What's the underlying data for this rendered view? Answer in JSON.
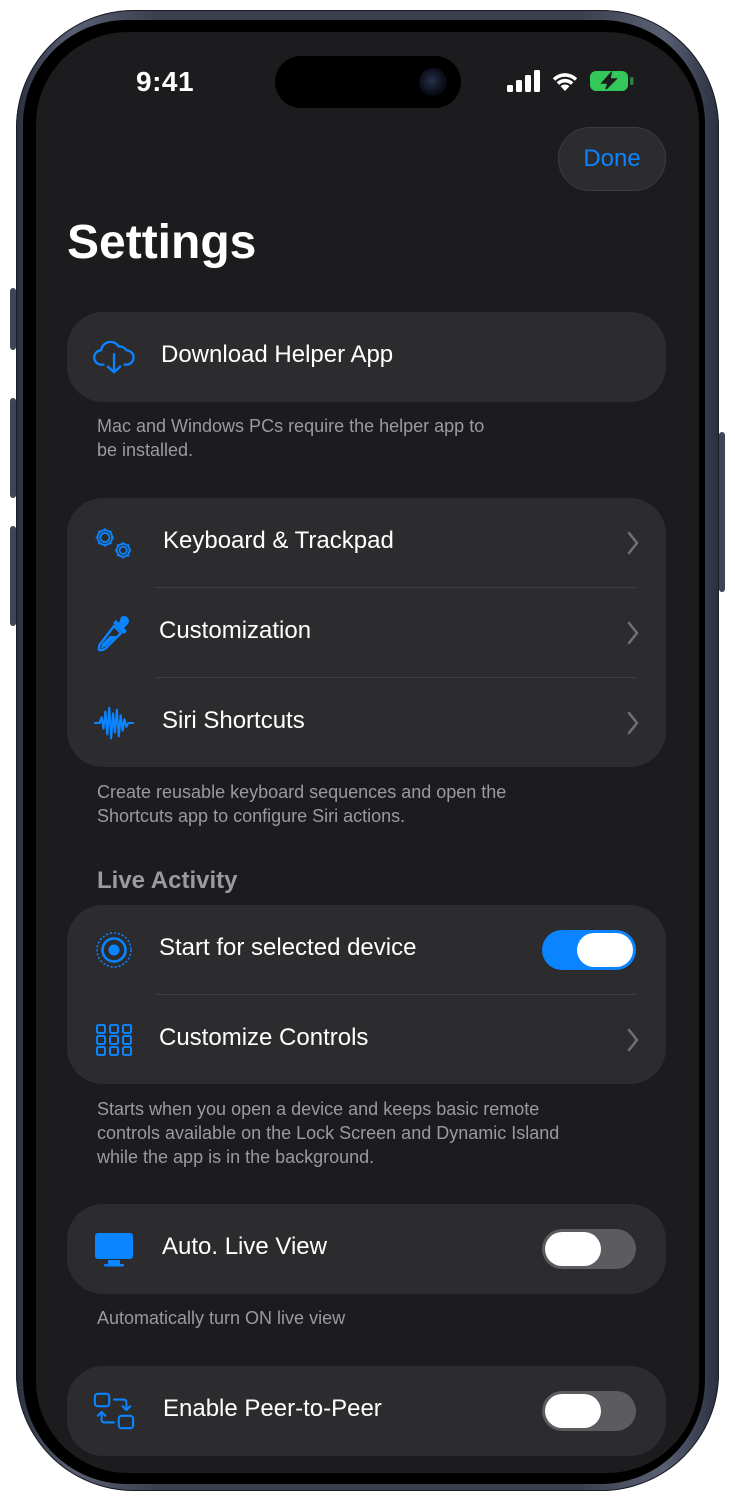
{
  "status_bar": {
    "time": "9:41"
  },
  "nav": {
    "done_label": "Done",
    "title": "Settings"
  },
  "colors": {
    "accent": "#0a84ff",
    "background": "#1c1c1e",
    "group": "#2c2c2e",
    "secondary_text": "#9a9a9f",
    "battery": "#34c759"
  },
  "helper_group": {
    "download": {
      "label": "Download Helper App",
      "icon": "cloud-download-icon"
    },
    "footer_line1": "Mac and Windows PCs require the helper app to",
    "footer_line2": "be installed."
  },
  "tools_group": {
    "items": [
      {
        "label": "Keyboard & Trackpad",
        "icon": "gears-icon"
      },
      {
        "label": "Customization",
        "icon": "eyedropper-icon"
      },
      {
        "label": "Siri Shortcuts",
        "icon": "waveform-icon"
      }
    ],
    "footer_line1": "Create reusable keyboard sequences and open the",
    "footer_line2": "Shortcuts app to configure Siri actions."
  },
  "live_activity": {
    "header": "Live Activity",
    "start": {
      "label": "Start for selected device",
      "icon": "target-icon",
      "enabled": true
    },
    "customize": {
      "label": "Customize Controls",
      "icon": "grid-icon"
    },
    "footer_line1": "Starts when you open a device and keeps basic remote",
    "footer_line2": "controls available on the Lock Screen and Dynamic Island",
    "footer_line3": "while the app is in the background."
  },
  "live_view": {
    "label": "Auto. Live View",
    "icon": "display-icon",
    "enabled": false,
    "footer": "Automatically turn ON live view"
  },
  "peer": {
    "label": "Enable Peer-to-Peer",
    "icon": "peer-arrows-icon",
    "enabled": false
  }
}
